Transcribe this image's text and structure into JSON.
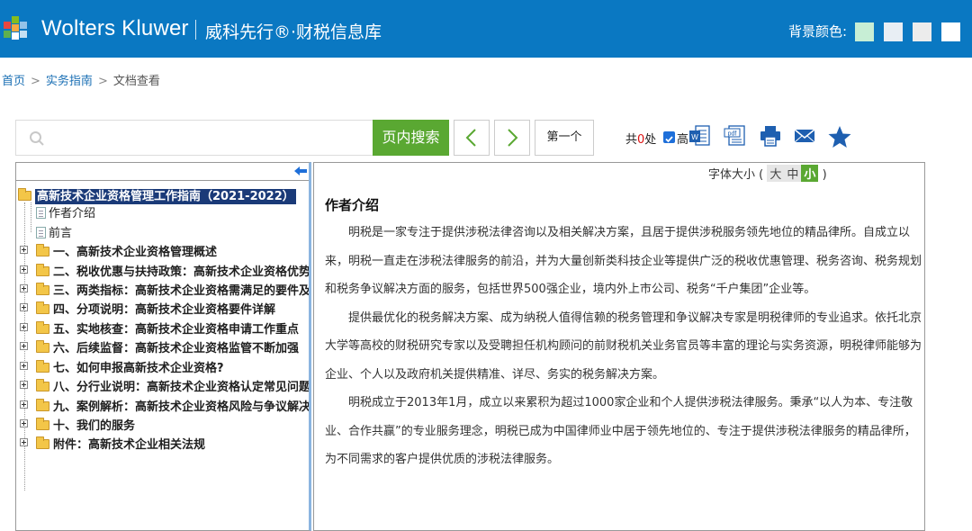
{
  "header": {
    "brand": "Wolters Kluwer",
    "brand_cn": "威科先行®·财税信息库",
    "bg_label": "背景颜色:",
    "swatch_colors": [
      "#c7eed5",
      "#e8eef4",
      "#ececec",
      "#ffffff"
    ]
  },
  "breadcrumb": {
    "home": "首页",
    "guide": "实务指南",
    "current": "文档查看"
  },
  "toolbar": {
    "search_placeholder": "",
    "search_button": "页内搜索",
    "first_button": "第一个",
    "count_prefix": "共",
    "count_value": "0",
    "count_suffix": "处",
    "highlight_label": "高",
    "icons": [
      "word-icon",
      "pdf-icon",
      "print-icon",
      "email-icon",
      "favorite-star-icon"
    ]
  },
  "tree": {
    "root": "高新技术企业资格管理工作指南（2021-2022）",
    "leaf_items": [
      "作者介绍",
      "前言"
    ],
    "chapters": [
      "一、高新技术企业资格管理概述",
      "二、税收优惠与扶持政策：高新技术企业资格优势所",
      "三、两类指标：高新技术企业资格需满足的要件及技",
      "四、分项说明：高新技术企业资格要件详解",
      "五、实地核查：高新技术企业资格申请工作重点",
      "六、后续监督：高新技术企业资格监管不断加强",
      "七、如何申报高新技术企业资格?",
      "八、分行业说明：高新技术企业资格认定常见问题",
      "九、案例解析：高新技术企业资格风险与争议解决",
      "十、我们的服务",
      "附件：高新技术企业相关法规"
    ]
  },
  "content": {
    "font_size_label": "字体大小",
    "font_open": "(",
    "font_close": ")",
    "font_large": "大",
    "font_medium": "中",
    "font_small": "小",
    "title": "作者介绍",
    "paragraphs": [
      "明税是一家专注于提供涉税法律咨询以及相关解决方案，且居于提供涉税服务领先地位的精品律所。自成立以来，明税一直走在涉税法律服务的前沿，并为大量创新类科技企业等提供广泛的税收优惠管理、税务咨询、税务规划和税务争议解决方面的服务，包括世界500强企业，境内外上市公司、税务“千户集团”企业等。",
      "提供最优化的税务解决方案、成为纳税人值得信赖的税务管理和争议解决专家是明税律师的专业追求。依托北京大学等高校的财税研究专家以及受聘担任机构顾问的前财税机关业务官员等丰富的理论与实务资源，明税律师能够为企业、个人以及政府机关提供精准、详尽、务实的税务解决方案。",
      "明税成立于2013年1月，成立以来累积为超过1000家企业和个人提供涉税法律服务。秉承“以人为本、专注敬业、合作共赢”的专业服务理念，明税已成为中国律师业中居于领先地位的、专注于提供涉税法律服务的精品律所，为不同需求的客户提供优质的涉税法律服务。"
    ]
  }
}
